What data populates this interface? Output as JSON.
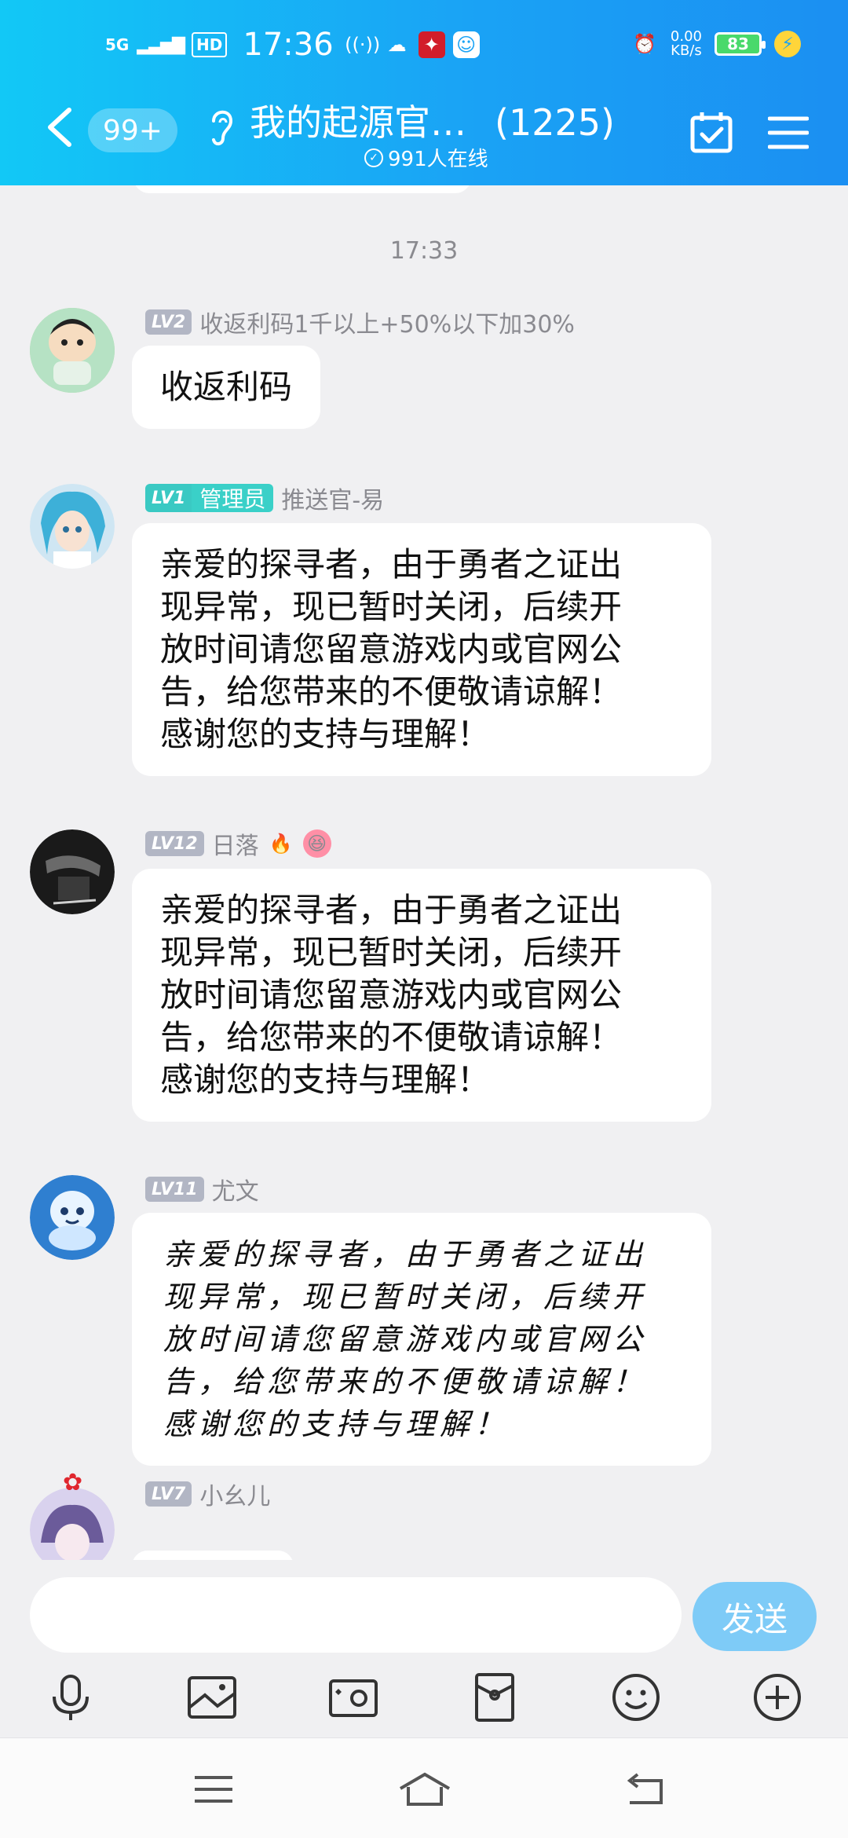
{
  "status_bar": {
    "network": "5G",
    "hd": "HD",
    "time": "17:36",
    "speed_value": "0.00",
    "speed_unit": "KB/s",
    "battery": "83"
  },
  "header": {
    "badge": "99+",
    "title": "我的起源官…",
    "member_count": "(1225)",
    "online": "991人在线"
  },
  "chat": {
    "timestamp": "17:33",
    "messages": [
      {
        "level": "LV2",
        "name": "收返利码1千以上+50%以下加30%",
        "text": "收返利码"
      },
      {
        "level": "LV1",
        "role": "管理员",
        "name": "推送官-易",
        "lines": [
          "亲爱的探寻者，由于勇者之证出",
          "现异常，现已暂时关闭，后续开",
          "放时间请您留意游戏内或官网公",
          "告，给您带来的不便敬请谅解！",
          "感谢您的支持与理解！"
        ]
      },
      {
        "level": "LV12",
        "name": "日落",
        "emoji1": "🔥",
        "emoji2": "😆",
        "lines": [
          "亲爱的探寻者，由于勇者之证出",
          "现异常，现已暂时关闭，后续开",
          "放时间请您留意游戏内或官网公",
          "告，给您带来的不便敬请谅解！",
          "感谢您的支持与理解！"
        ]
      },
      {
        "level": "LV11",
        "name": "尤文",
        "lines": [
          "亲爱的探寻者，由于勇者之证出",
          "现异常，现已暂时关闭，后续开",
          "放时间请您留意游戏内或官网公",
          "告，给您带来的不便敬请谅解！",
          "感谢您的支持与理解！"
        ]
      },
      {
        "level": "LV7",
        "name": "小幺儿"
      }
    ]
  },
  "input": {
    "send_label": "发送"
  },
  "colors": {
    "header_start": "#12c8f6",
    "header_end": "#1b8ff2",
    "send_button": "#7ecbf7",
    "admin_badge": "#3ac9c3"
  }
}
